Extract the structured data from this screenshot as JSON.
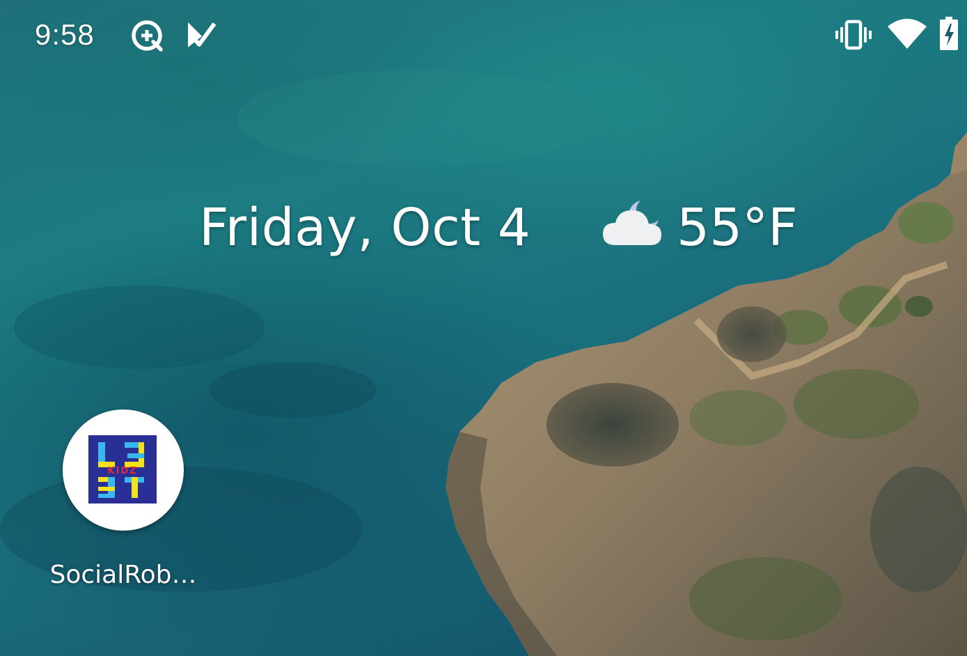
{
  "status_bar": {
    "time": "9:58",
    "left_icons": [
      "data-saver-icon",
      "play-store-notification-icon"
    ],
    "right_icons": [
      "vibrate-icon",
      "wifi-icon",
      "battery-charging-icon"
    ]
  },
  "at_a_glance": {
    "date": "Friday, Oct 4",
    "weather_icon": "partly-cloudy-night-icon",
    "temperature": "55°F"
  },
  "home_apps": [
    {
      "label": "SocialRob…",
      "icon": "app-logo-icon",
      "logo_text": "KIDZ"
    }
  ],
  "colors": {
    "wallpaper_water": "#1c7d82",
    "wallpaper_land": "#8a7a5e",
    "app_logo_bg": "#2a2f96",
    "text": "#ffffff"
  }
}
